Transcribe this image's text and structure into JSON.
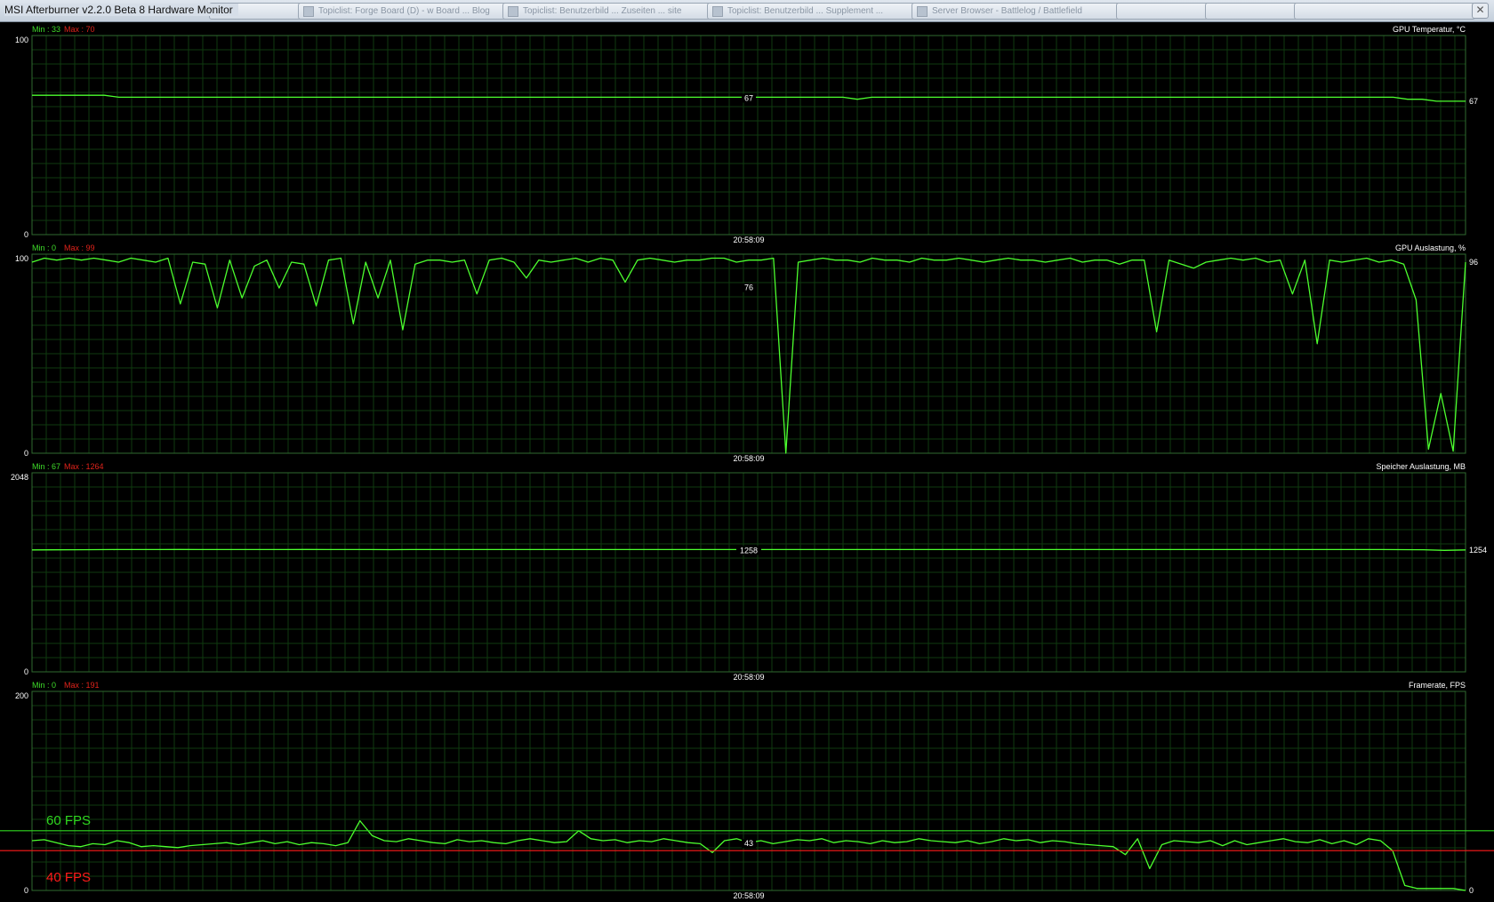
{
  "window": {
    "title": "MSI Afterburner v2.2.0 Beta 8 Hardware Monitor",
    "background_tabs": [
      "Topiclist: Forge Board (D) - w Board ... Blog",
      "Topiclist: Benutzerbild ... Zuseiten ... site",
      "Topiclist: Benutzerbild ... Supplement ...",
      "Server Browser - Battlelog / Battlefield"
    ],
    "close_glyph": "✕"
  },
  "timestamp": "20:58:09",
  "colors": {
    "line": "#4cff2e",
    "grid": "#0f3a0f",
    "border": "#2f6a2f",
    "min_label": "#3fdc2a",
    "max_label": "#e0231b",
    "axis_text": "#ffffff",
    "ref_60": "#2fd81f",
    "ref_40": "#ff1a1a"
  },
  "graphs": [
    {
      "id": "gpu-temperature",
      "title": "GPU Temperatur, °C",
      "min_label": "Min : 33",
      "max_label": "Max : 70",
      "y_max": "100",
      "y_min": "0",
      "range": [
        0,
        100
      ],
      "mid_value": "67",
      "current_value": "67",
      "timestamp": "20:58:09"
    },
    {
      "id": "gpu-load",
      "title": "GPU Auslastung, %",
      "min_label": "Min : 0",
      "max_label": "Max : 99",
      "y_max": "100",
      "y_min": "0",
      "range": [
        0,
        100
      ],
      "mid_value": "76",
      "current_value": "96",
      "timestamp": "20:58:09"
    },
    {
      "id": "memory-usage",
      "title": "Speicher Auslastung, MB",
      "min_label": "Min : 67",
      "max_label": "Max : 1264",
      "y_max": "2048",
      "y_min": "0",
      "range": [
        0,
        2048
      ],
      "mid_value": "1258",
      "current_value": "1254",
      "timestamp": "20:58:09"
    },
    {
      "id": "framerate",
      "title": "Framerate, FPS",
      "min_label": "Min : 0",
      "max_label": "Max : 191",
      "y_max": "200",
      "y_min": "0",
      "range": [
        0,
        200
      ],
      "mid_value": "43",
      "current_value": "0",
      "timestamp": "20:58:09"
    }
  ],
  "chart_data": [
    {
      "type": "line",
      "title": "GPU Temperatur, °C",
      "ylim": [
        0,
        100
      ],
      "series": [
        {
          "name": "GPU Temperatur, °C",
          "values": [
            70,
            70,
            70,
            70,
            70,
            70,
            69,
            69,
            69,
            69,
            69,
            69,
            69,
            69,
            69,
            69,
            69,
            69,
            69,
            69,
            69,
            69,
            69,
            69,
            69,
            69,
            69,
            69,
            69,
            69,
            69,
            69,
            69,
            69,
            69,
            69,
            69,
            69,
            69,
            69,
            69,
            69,
            69,
            69,
            69,
            69,
            69,
            69,
            69,
            69,
            69,
            69,
            69,
            69,
            69,
            69,
            69,
            68,
            69,
            69,
            69,
            69,
            69,
            69,
            69,
            69,
            69,
            69,
            69,
            69,
            69,
            69,
            69,
            69,
            69,
            69,
            69,
            69,
            69,
            69,
            69,
            69,
            69,
            69,
            69,
            69,
            69,
            69,
            69,
            69,
            69,
            69,
            69,
            69,
            69,
            68,
            68,
            67,
            67,
            67
          ]
        }
      ]
    },
    {
      "type": "line",
      "title": "GPU Auslastung, %",
      "ylim": [
        0,
        100
      ],
      "series": [
        {
          "name": "GPU Auslastung, %",
          "values": [
            96,
            98,
            97,
            98,
            97,
            98,
            97,
            96,
            98,
            97,
            96,
            98,
            75,
            96,
            95,
            73,
            97,
            78,
            94,
            97,
            83,
            96,
            95,
            74,
            97,
            98,
            65,
            96,
            78,
            97,
            62,
            95,
            97,
            97,
            96,
            97,
            80,
            97,
            98,
            96,
            88,
            97,
            96,
            97,
            98,
            96,
            98,
            97,
            86,
            97,
            98,
            97,
            96,
            97,
            97,
            98,
            98,
            96,
            97,
            97,
            98,
            0,
            96,
            97,
            98,
            97,
            97,
            96,
            98,
            97,
            97,
            96,
            98,
            97,
            97,
            98,
            97,
            96,
            97,
            98,
            97,
            97,
            96,
            97,
            98,
            96,
            97,
            97,
            95,
            97,
            97,
            61,
            97,
            95,
            93,
            96,
            97,
            98,
            97,
            98,
            96,
            97,
            80,
            97,
            55,
            97,
            96,
            97,
            98,
            96,
            97,
            95,
            77,
            2,
            30,
            1,
            96
          ]
        }
      ]
    },
    {
      "type": "line",
      "title": "Speicher Auslastung, MB",
      "ylim": [
        0,
        2048
      ],
      "series": [
        {
          "name": "Speicher Auslastung, MB",
          "values": [
            1254,
            1255,
            1256,
            1257,
            1258,
            1258,
            1258,
            1259,
            1258,
            1258,
            1258,
            1258,
            1258,
            1259,
            1258,
            1258,
            1258,
            1257,
            1258,
            1258,
            1258,
            1258,
            1258,
            1258,
            1258,
            1258,
            1258,
            1258,
            1258,
            1258,
            1258,
            1258,
            1258,
            1258,
            1258,
            1258,
            1258,
            1258,
            1258,
            1258,
            1258,
            1258,
            1258,
            1258,
            1258,
            1258,
            1258,
            1258,
            1258,
            1258,
            1258,
            1258,
            1258,
            1258,
            1258,
            1258,
            1258,
            1258,
            1258,
            1258,
            1258,
            1258,
            1258,
            1258,
            1258,
            1257,
            1256,
            1250,
            1254
          ]
        }
      ]
    },
    {
      "type": "line",
      "title": "Framerate, FPS",
      "ylim": [
        0,
        200
      ],
      "series": [
        {
          "name": "Framerate, FPS",
          "values": [
            50,
            51,
            48,
            45,
            44,
            47,
            46,
            50,
            48,
            44,
            45,
            44,
            43,
            45,
            46,
            47,
            48,
            46,
            48,
            50,
            47,
            49,
            46,
            48,
            47,
            45,
            48,
            70,
            55,
            50,
            49,
            52,
            50,
            48,
            47,
            51,
            49,
            50,
            48,
            47,
            50,
            52,
            50,
            48,
            49,
            60,
            52,
            50,
            51,
            48,
            50,
            49,
            52,
            50,
            48,
            47,
            38,
            50,
            52,
            48,
            50,
            47,
            49,
            51,
            50,
            52,
            48,
            50,
            49,
            47,
            50,
            48,
            49,
            52,
            50,
            49,
            48,
            50,
            47,
            49,
            52,
            50,
            51,
            48,
            50,
            49,
            47,
            46,
            45,
            44,
            36,
            52,
            22,
            46,
            50,
            49,
            48,
            50,
            45,
            50,
            46,
            48,
            50,
            52,
            49,
            48,
            51,
            47,
            50,
            46,
            52,
            50,
            40,
            5,
            2,
            2,
            2,
            2,
            0
          ]
        }
      ]
    }
  ],
  "reference_lines": {
    "fps_60": {
      "label": "60 FPS",
      "value": 60
    },
    "fps_40": {
      "label": "40 FPS",
      "value": 40
    }
  }
}
